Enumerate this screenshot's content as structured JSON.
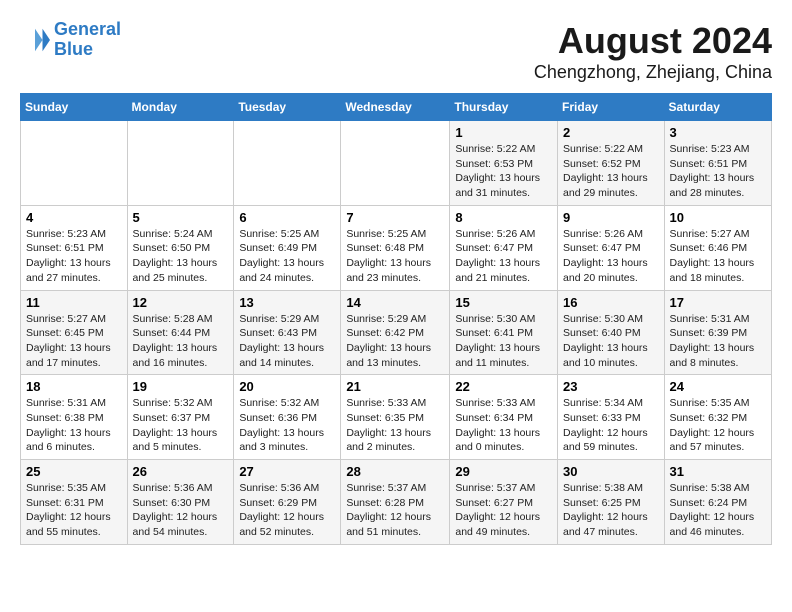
{
  "header": {
    "logo_line1": "General",
    "logo_line2": "Blue",
    "month": "August 2024",
    "location": "Chengzhong, Zhejiang, China"
  },
  "weekdays": [
    "Sunday",
    "Monday",
    "Tuesday",
    "Wednesday",
    "Thursday",
    "Friday",
    "Saturday"
  ],
  "weeks": [
    [
      {
        "day": "",
        "info": ""
      },
      {
        "day": "",
        "info": ""
      },
      {
        "day": "",
        "info": ""
      },
      {
        "day": "",
        "info": ""
      },
      {
        "day": "1",
        "info": "Sunrise: 5:22 AM\nSunset: 6:53 PM\nDaylight: 13 hours\nand 31 minutes."
      },
      {
        "day": "2",
        "info": "Sunrise: 5:22 AM\nSunset: 6:52 PM\nDaylight: 13 hours\nand 29 minutes."
      },
      {
        "day": "3",
        "info": "Sunrise: 5:23 AM\nSunset: 6:51 PM\nDaylight: 13 hours\nand 28 minutes."
      }
    ],
    [
      {
        "day": "4",
        "info": "Sunrise: 5:23 AM\nSunset: 6:51 PM\nDaylight: 13 hours\nand 27 minutes."
      },
      {
        "day": "5",
        "info": "Sunrise: 5:24 AM\nSunset: 6:50 PM\nDaylight: 13 hours\nand 25 minutes."
      },
      {
        "day": "6",
        "info": "Sunrise: 5:25 AM\nSunset: 6:49 PM\nDaylight: 13 hours\nand 24 minutes."
      },
      {
        "day": "7",
        "info": "Sunrise: 5:25 AM\nSunset: 6:48 PM\nDaylight: 13 hours\nand 23 minutes."
      },
      {
        "day": "8",
        "info": "Sunrise: 5:26 AM\nSunset: 6:47 PM\nDaylight: 13 hours\nand 21 minutes."
      },
      {
        "day": "9",
        "info": "Sunrise: 5:26 AM\nSunset: 6:47 PM\nDaylight: 13 hours\nand 20 minutes."
      },
      {
        "day": "10",
        "info": "Sunrise: 5:27 AM\nSunset: 6:46 PM\nDaylight: 13 hours\nand 18 minutes."
      }
    ],
    [
      {
        "day": "11",
        "info": "Sunrise: 5:27 AM\nSunset: 6:45 PM\nDaylight: 13 hours\nand 17 minutes."
      },
      {
        "day": "12",
        "info": "Sunrise: 5:28 AM\nSunset: 6:44 PM\nDaylight: 13 hours\nand 16 minutes."
      },
      {
        "day": "13",
        "info": "Sunrise: 5:29 AM\nSunset: 6:43 PM\nDaylight: 13 hours\nand 14 minutes."
      },
      {
        "day": "14",
        "info": "Sunrise: 5:29 AM\nSunset: 6:42 PM\nDaylight: 13 hours\nand 13 minutes."
      },
      {
        "day": "15",
        "info": "Sunrise: 5:30 AM\nSunset: 6:41 PM\nDaylight: 13 hours\nand 11 minutes."
      },
      {
        "day": "16",
        "info": "Sunrise: 5:30 AM\nSunset: 6:40 PM\nDaylight: 13 hours\nand 10 minutes."
      },
      {
        "day": "17",
        "info": "Sunrise: 5:31 AM\nSunset: 6:39 PM\nDaylight: 13 hours\nand 8 minutes."
      }
    ],
    [
      {
        "day": "18",
        "info": "Sunrise: 5:31 AM\nSunset: 6:38 PM\nDaylight: 13 hours\nand 6 minutes."
      },
      {
        "day": "19",
        "info": "Sunrise: 5:32 AM\nSunset: 6:37 PM\nDaylight: 13 hours\nand 5 minutes."
      },
      {
        "day": "20",
        "info": "Sunrise: 5:32 AM\nSunset: 6:36 PM\nDaylight: 13 hours\nand 3 minutes."
      },
      {
        "day": "21",
        "info": "Sunrise: 5:33 AM\nSunset: 6:35 PM\nDaylight: 13 hours\nand 2 minutes."
      },
      {
        "day": "22",
        "info": "Sunrise: 5:33 AM\nSunset: 6:34 PM\nDaylight: 13 hours\nand 0 minutes."
      },
      {
        "day": "23",
        "info": "Sunrise: 5:34 AM\nSunset: 6:33 PM\nDaylight: 12 hours\nand 59 minutes."
      },
      {
        "day": "24",
        "info": "Sunrise: 5:35 AM\nSunset: 6:32 PM\nDaylight: 12 hours\nand 57 minutes."
      }
    ],
    [
      {
        "day": "25",
        "info": "Sunrise: 5:35 AM\nSunset: 6:31 PM\nDaylight: 12 hours\nand 55 minutes."
      },
      {
        "day": "26",
        "info": "Sunrise: 5:36 AM\nSunset: 6:30 PM\nDaylight: 12 hours\nand 54 minutes."
      },
      {
        "day": "27",
        "info": "Sunrise: 5:36 AM\nSunset: 6:29 PM\nDaylight: 12 hours\nand 52 minutes."
      },
      {
        "day": "28",
        "info": "Sunrise: 5:37 AM\nSunset: 6:28 PM\nDaylight: 12 hours\nand 51 minutes."
      },
      {
        "day": "29",
        "info": "Sunrise: 5:37 AM\nSunset: 6:27 PM\nDaylight: 12 hours\nand 49 minutes."
      },
      {
        "day": "30",
        "info": "Sunrise: 5:38 AM\nSunset: 6:25 PM\nDaylight: 12 hours\nand 47 minutes."
      },
      {
        "day": "31",
        "info": "Sunrise: 5:38 AM\nSunset: 6:24 PM\nDaylight: 12 hours\nand 46 minutes."
      }
    ]
  ]
}
